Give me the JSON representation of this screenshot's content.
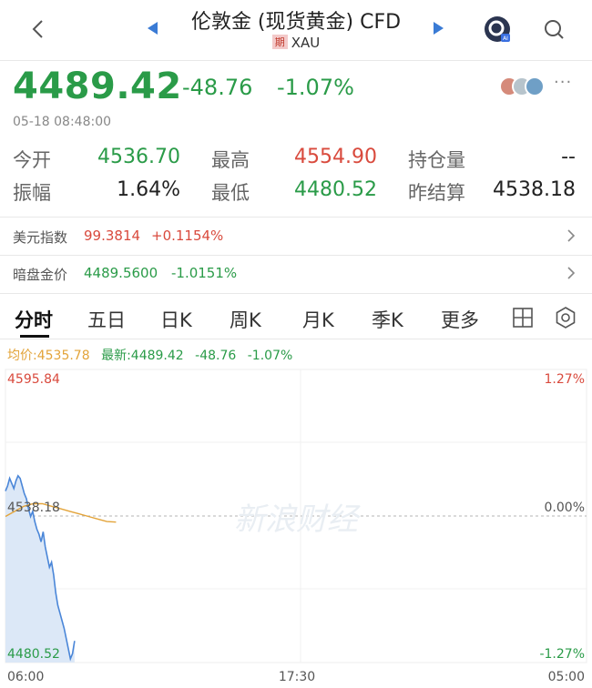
{
  "header": {
    "title": "伦敦金 (现货黄金) CFD",
    "badge": "期",
    "symbol": "XAU"
  },
  "quote": {
    "price": "4489.42",
    "change": "-48.76",
    "change_pct": "-1.07%",
    "timestamp": "05-18 08:48:00",
    "more": "···"
  },
  "stats": {
    "open_label": "今开",
    "open": "4536.70",
    "high_label": "最高",
    "high": "4554.90",
    "oi_label": "持仓量",
    "oi": "--",
    "amp_label": "振幅",
    "amp": "1.64%",
    "low_label": "最低",
    "low": "4480.52",
    "settle_label": "昨结算",
    "settle": "4538.18"
  },
  "rows": [
    {
      "label": "美元指数",
      "value": "99.3814",
      "change": "+0.1154%"
    },
    {
      "label": "暗盘金价",
      "value": "4489.5600",
      "change": "-1.0151%"
    }
  ],
  "tabs": [
    "分时",
    "五日",
    "日K",
    "周K",
    "月K",
    "季K",
    "更多"
  ],
  "legend": {
    "avg": "均价:4535.78",
    "latest": "最新:4489.42",
    "change": "-48.76",
    "pct": "-1.07%"
  },
  "colors": {
    "up": "#d94a3d",
    "down": "#2a9b48",
    "line": "#4a86d8",
    "avg": "#e3a43a"
  },
  "chart_data": {
    "type": "line",
    "y_top_label": "4595.84",
    "y_mid_label": "4538.18",
    "y_bottom_label": "4480.52",
    "pct_top": "1.27%",
    "pct_mid": "0.00%",
    "pct_bottom": "-1.27%",
    "ylim": [
      4480.52,
      4595.84
    ],
    "x_ticks": [
      "06:00",
      "17:30",
      "05:00"
    ],
    "watermark": "新浪财经",
    "series": [
      {
        "values": [
          4548,
          4550,
          4553,
          4551,
          4549,
          4552,
          4554,
          4553,
          4550,
          4547,
          4545,
          4541,
          4538,
          4540,
          4536,
          4533,
          4531,
          4528,
          4532,
          4526,
          4522,
          4518,
          4520,
          4515,
          4508,
          4503,
          4500,
          4497,
          4494,
          4490,
          4486,
          4482,
          4484,
          4489
        ]
      },
      {
        "values": [
          4538,
          4540,
          4542,
          4543,
          4543,
          4542,
          4541,
          4540,
          4539,
          4538,
          4537,
          4536,
          4535.78
        ]
      }
    ]
  }
}
